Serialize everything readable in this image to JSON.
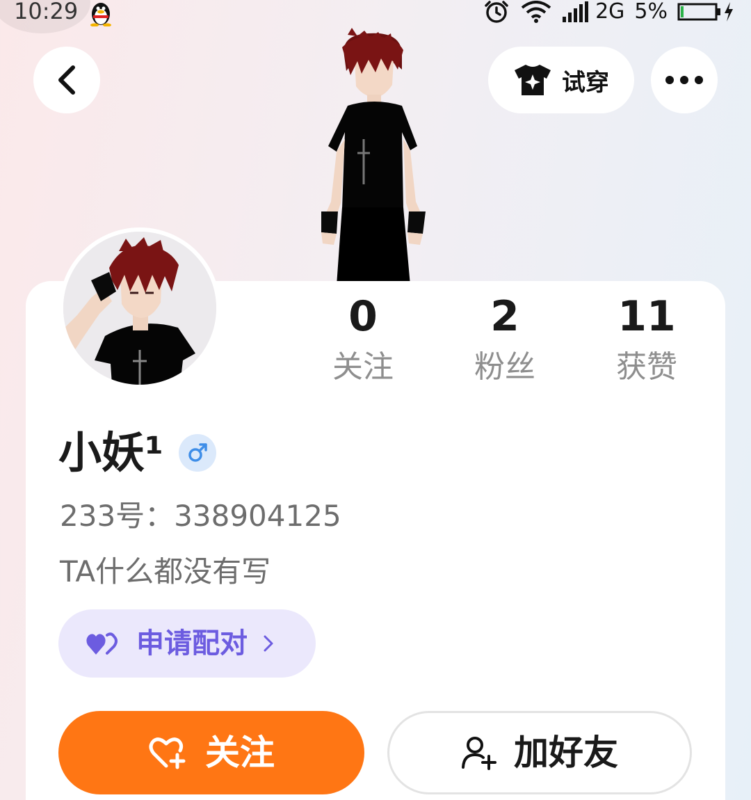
{
  "status_bar": {
    "time": "10:29",
    "network": "2G",
    "battery": "5%",
    "icons": [
      "qq-penguin-icon",
      "alarm-icon",
      "wifi-icon",
      "signal-icon",
      "battery-icon",
      "charging-icon"
    ]
  },
  "header": {
    "back_icon": "chevron-left-icon",
    "tryon_label": "试穿",
    "tryon_icon": "tshirt-icon",
    "more_icon": "more-dots-icon"
  },
  "stats": [
    {
      "value": "0",
      "label": "关注"
    },
    {
      "value": "2",
      "label": "粉丝"
    },
    {
      "value": "11",
      "label": "获赞"
    }
  ],
  "profile": {
    "username": "小妖¹",
    "gender_icon": "male-icon",
    "id_text": "233号：338904125",
    "bio": "TA什么都没有写"
  },
  "pair_button": {
    "label": "申请配对",
    "icon": "hearts-icon"
  },
  "actions": {
    "follow_label": "关注",
    "follow_icon": "heart-plus-icon",
    "add_friend_label": "加好友",
    "add_friend_icon": "user-plus-icon"
  },
  "colors": {
    "follow_bg": "#ff7614",
    "pair_bg": "#ebe8fc",
    "pair_text": "#6c5ce0",
    "male_badge": "#3f8ee8"
  }
}
